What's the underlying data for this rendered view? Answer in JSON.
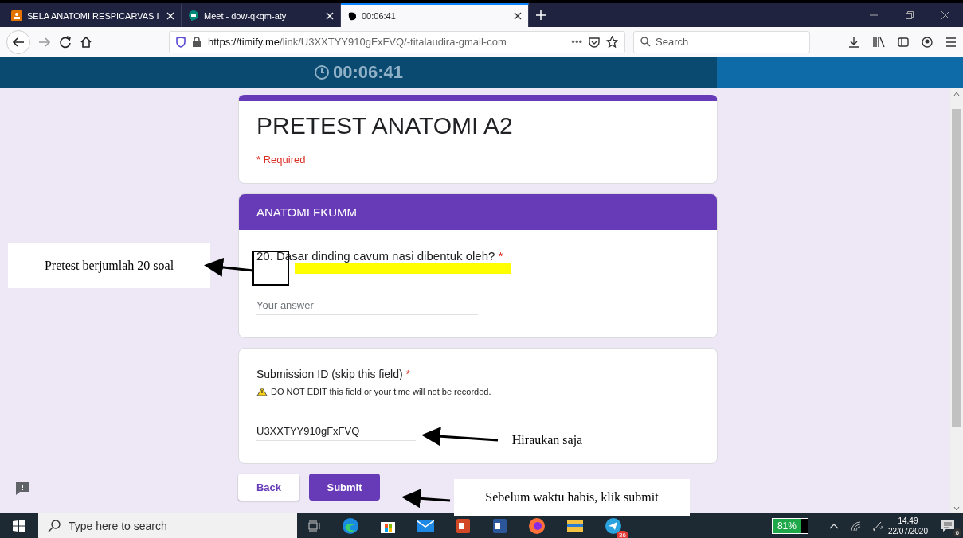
{
  "tabs": [
    {
      "label": "SELA ANATOMI RESPICARVAS I",
      "selected": false
    },
    {
      "label": "Meet - dow-qkqm-aty",
      "selected": false
    },
    {
      "label": "00:06:41",
      "selected": true
    }
  ],
  "toolbar": {
    "url_host": "https://timify.me",
    "url_path": "/link/U3XXTYY910gFxFVQ/-titalaudira-gmail-com",
    "more": "•••",
    "search_placeholder": "Search"
  },
  "timer": {
    "time": "00:06:41"
  },
  "form": {
    "title": "PRETEST ANATOMI A2",
    "required_note": "* Required",
    "section": "ANATOMI FKUMM",
    "question": {
      "text": "20. Dasar dinding cavum nasi dibentuk oleh?",
      "required_mark": "*",
      "placeholder": "Your answer"
    },
    "submission": {
      "label": "Submission ID (skip this field)",
      "required_mark": "*",
      "warning": "DO NOT EDIT this field or your time will not be recorded.",
      "value": "U3XXTYY910gFxFVQ"
    },
    "buttons": [
      {
        "label": "Back",
        "kind": "secondary"
      },
      {
        "label": "Submit",
        "kind": "primary"
      }
    ]
  },
  "annotations": [
    {
      "text": "Pretest berjumlah 20 soal",
      "boxed": true
    },
    {
      "text": "Hiraukan saja",
      "boxed": false
    },
    {
      "text": "Sebelum waktu habis, klik submit",
      "boxed": true
    }
  ],
  "taskbar": {
    "search_placeholder": "Type here to search",
    "telegram_badge": "36",
    "battery": {
      "label": "81%",
      "level": 0.81
    },
    "time": "14.49",
    "date": "22/07/2020",
    "notifications": "6"
  }
}
